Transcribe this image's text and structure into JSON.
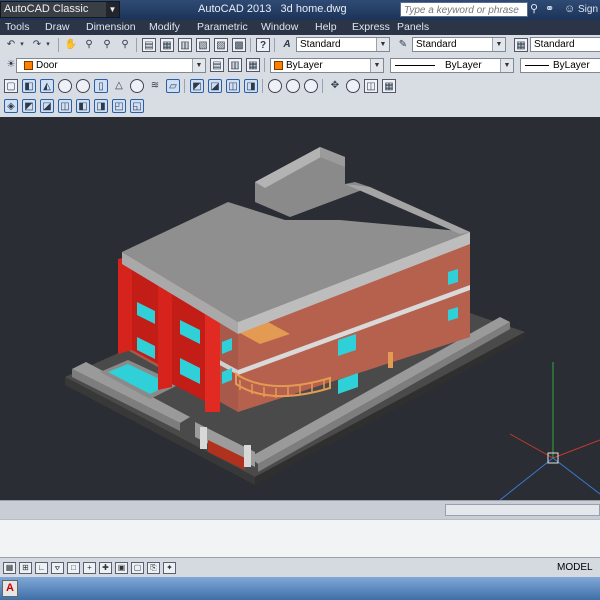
{
  "titlebar": {
    "workspace": "AutoCAD Classic",
    "title": "AutoCAD 2013   3d home.dwg",
    "search_placeholder": "Type a keyword or phrase",
    "signin": "Sign"
  },
  "menu": [
    "Tools",
    "Draw",
    "Dimension",
    "Modify",
    "Parametric",
    "Window",
    "Help",
    "Express",
    "Panels"
  ],
  "toolbar1": {
    "text_style": "Standard",
    "dim_style": "Standard",
    "table_style": "Standard"
  },
  "toolbar2": {
    "layer": "Door",
    "color": "ByLayer",
    "linetype": "ByLayer",
    "lineweight": "ByLayer"
  },
  "status": {
    "model": "MODEL"
  },
  "colors": {
    "titlebar": "#1c3358",
    "viewport": "#2a2d33",
    "accent_red": "#d6241c",
    "glass": "#2fd0d8",
    "brick": "#b05a47",
    "roof": "#8f8f8f",
    "railing": "#e39a52",
    "layer_orange": "#ff8000"
  },
  "icons": [
    "undo-icon",
    "redo-icon",
    "pan-icon",
    "zoom-icon",
    "layer-icon",
    "search-icon",
    "binoculars-icon",
    "user-icon",
    "autocad-icon"
  ]
}
